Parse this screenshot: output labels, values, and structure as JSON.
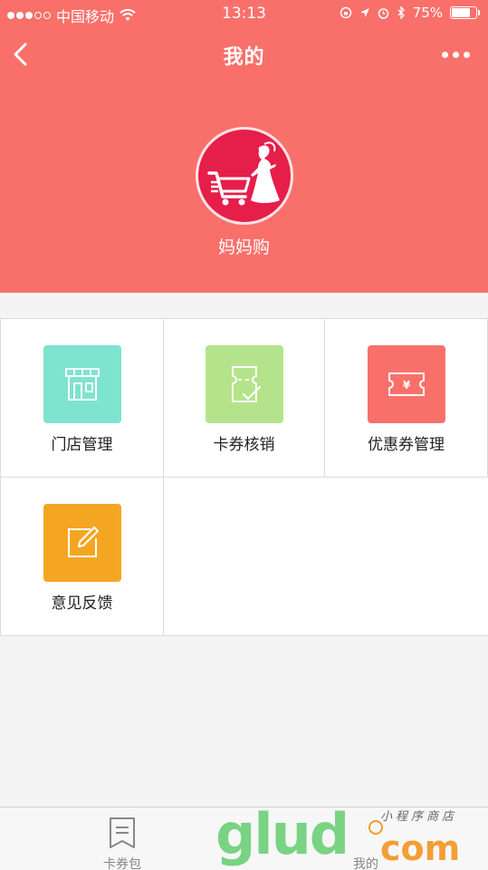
{
  "status_bar": {
    "carrier": "中国移动",
    "time": "13:13",
    "battery": "75%",
    "battery_level": 0.75
  },
  "nav": {
    "title": "我的"
  },
  "profile": {
    "name": "妈妈购"
  },
  "menu": [
    {
      "label": "门店管理",
      "color": "#7ee3cf",
      "icon": "store-icon"
    },
    {
      "label": "卡券核销",
      "color": "#b5e38b",
      "icon": "coupon-verify-icon"
    },
    {
      "label": "优惠券管理",
      "color": "#f9706b",
      "icon": "yen-ticket-icon"
    },
    {
      "label": "意见反馈",
      "color": "#f4a623",
      "icon": "edit-note-icon"
    }
  ],
  "tabbar": {
    "tabs": [
      {
        "label": "卡券包",
        "icon": "bookmark-icon"
      },
      {
        "label": "我的",
        "icon": "user-icon"
      }
    ]
  },
  "watermark": {
    "brand": "glud",
    "domain": "com",
    "tagline": "小程序商店"
  },
  "colors": {
    "header": "#f9706b",
    "background": "#f4f4f4"
  }
}
